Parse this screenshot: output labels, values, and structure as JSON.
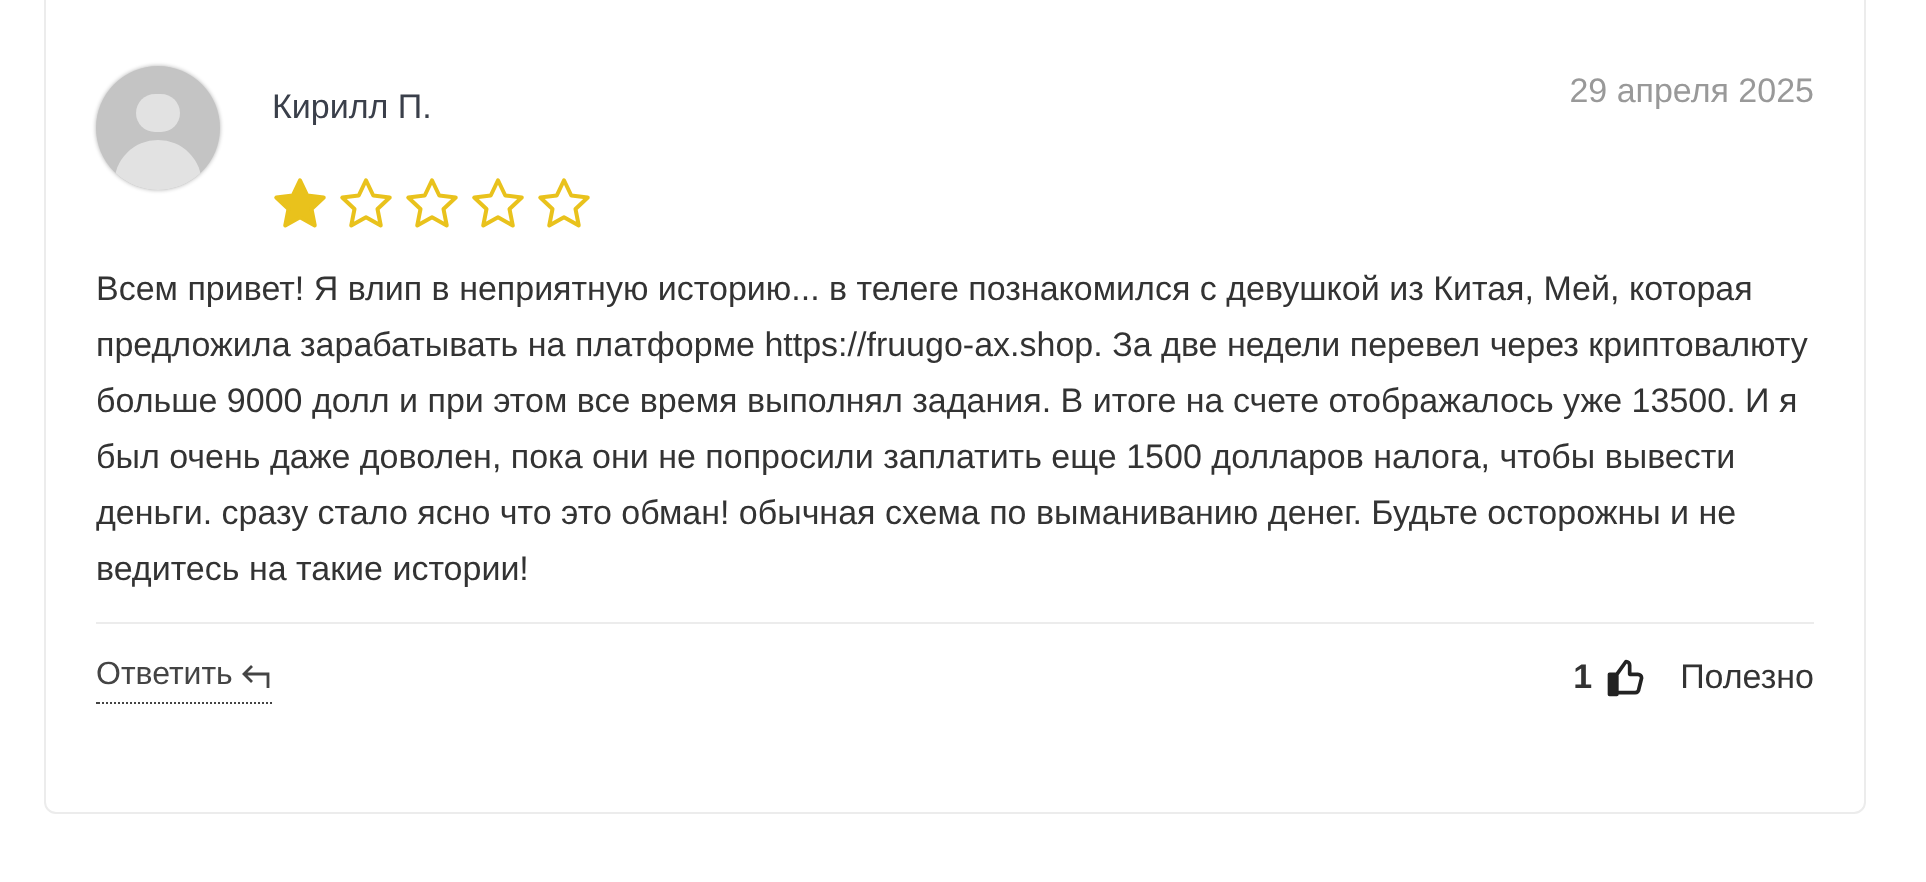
{
  "review": {
    "author": "Кирилл П.",
    "date": "29 апреля 2025",
    "stars": 1,
    "text": "Всем привет! Я влип в неприятную историю... в телеге познакомился с девушкой из Китая, Мей, которая предложила зарабатывать на платформе https://fruugo-ax.shop. За две недели перевел через криптовалюту больше 9000 долл и при этом все время выполнял задания. В итоге на счете отображалось уже 13500. И я был очень даже доволен, пока они не попросили заплатить еще 1500 долларов налога, чтобы вывести деньги. сразу стало ясно что это обман! обычная схема по выманиванию денег. Будьте осторожны и не ведитесь на такие истории!",
    "reply_label": "Ответить",
    "helpful_count": "1",
    "helpful_label": "Полезно"
  }
}
